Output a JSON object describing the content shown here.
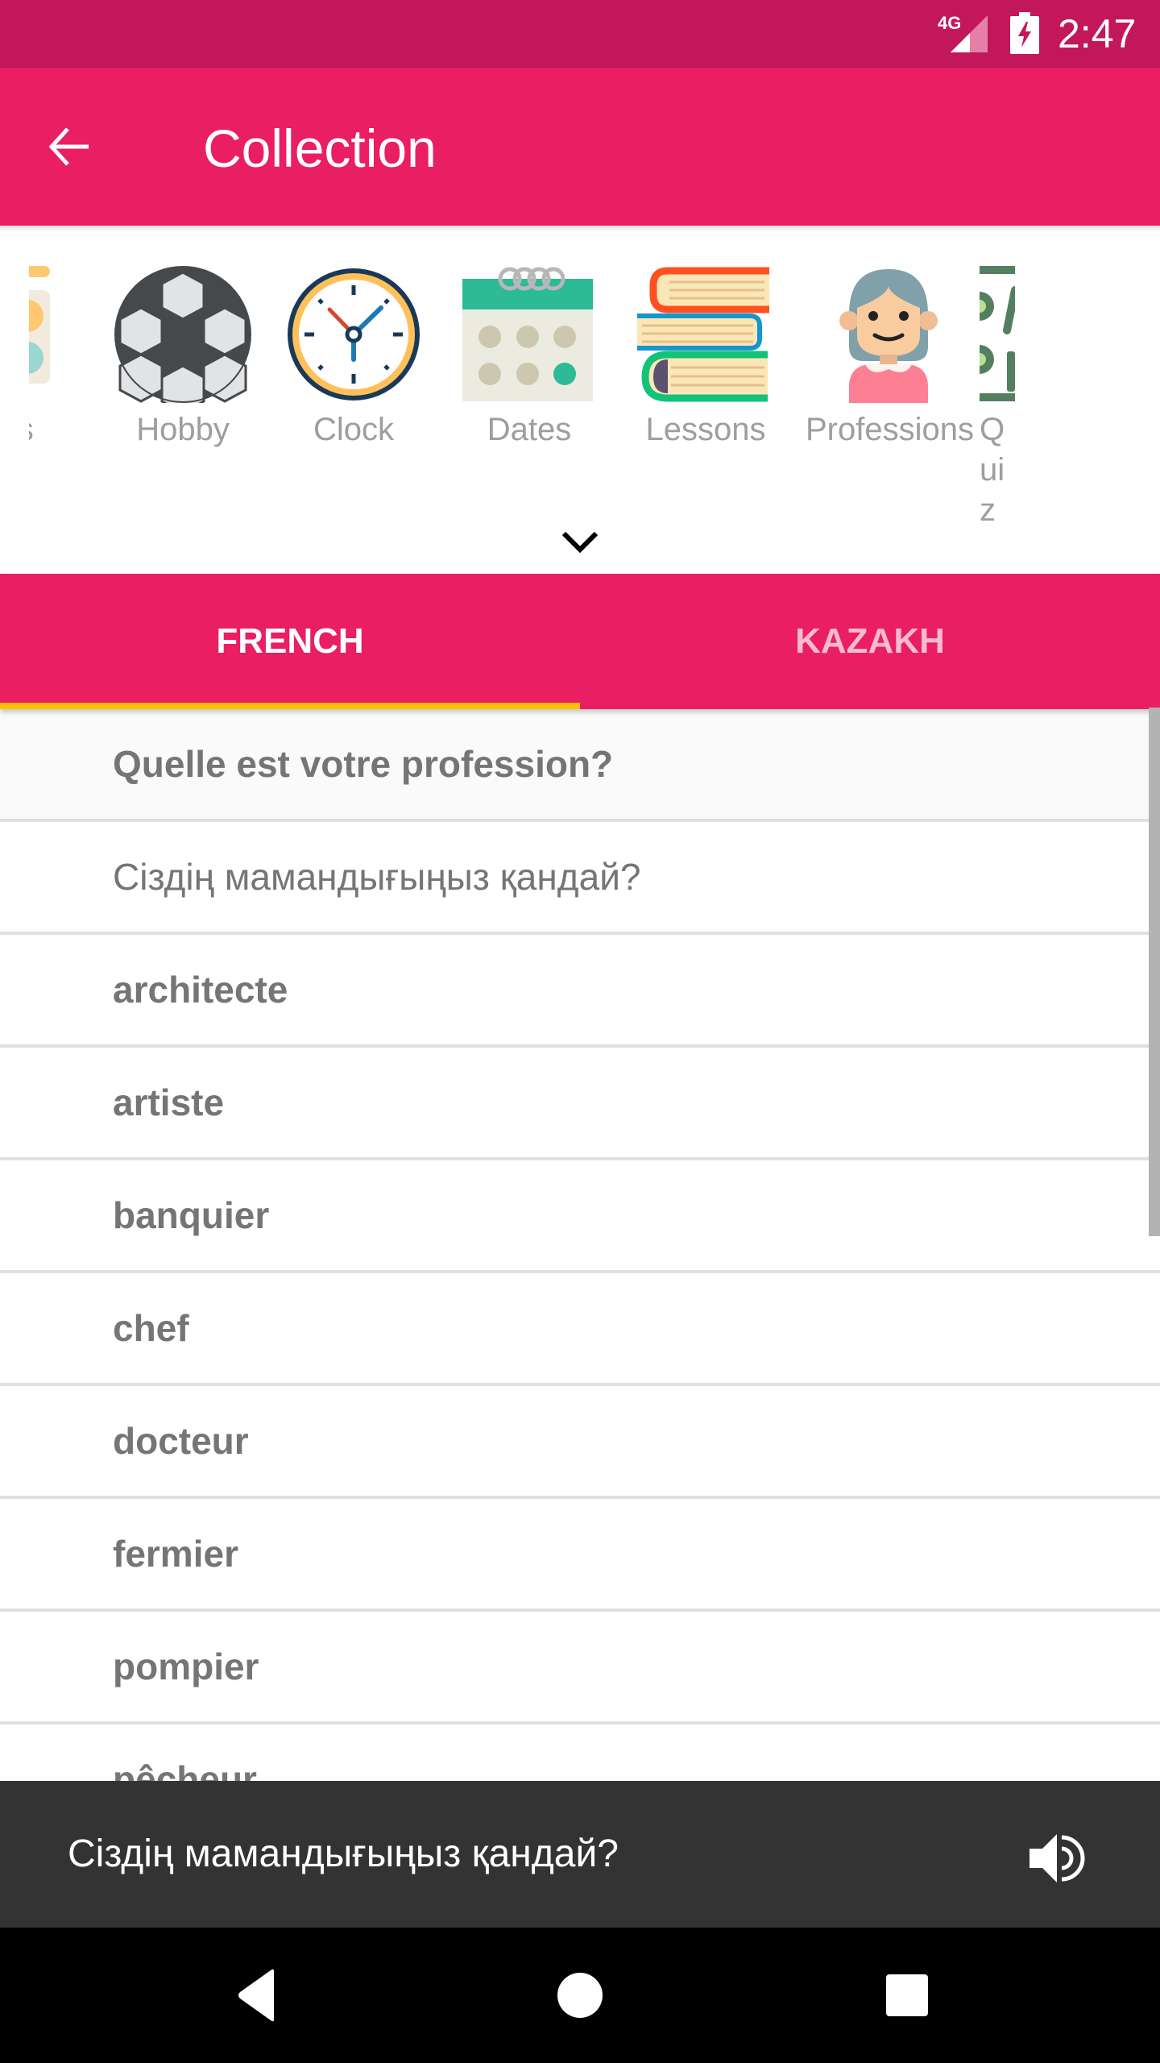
{
  "status_bar": {
    "network": "4G",
    "time": "2:47",
    "background_color": "#c2185b"
  },
  "app_bar": {
    "title": "Collection",
    "back_icon": "arrow-left-icon",
    "background_color": "#e91e63"
  },
  "categories": {
    "items": [
      {
        "label": "Colors",
        "visible_label": "ors",
        "icon": "palette-icon"
      },
      {
        "label": "Hobby",
        "visible_label": "Hobby",
        "icon": "soccer-ball-icon"
      },
      {
        "label": "Clock",
        "visible_label": "Clock",
        "icon": "clock-icon"
      },
      {
        "label": "Dates",
        "visible_label": "Dates",
        "icon": "calendar-icon"
      },
      {
        "label": "Lessons",
        "visible_label": "Lessons",
        "icon": "books-icon"
      },
      {
        "label": "Professions",
        "visible_label": "Professions",
        "icon": "person-icon"
      },
      {
        "label": "Quiz",
        "visible_label": "Quiz",
        "icon": "quiz-icon"
      }
    ],
    "expand_icon": "chevron-down-icon"
  },
  "tabs": [
    {
      "label": "FRENCH",
      "active": true
    },
    {
      "label": "KAZAKH",
      "active": false
    }
  ],
  "tab_indicator_color": "#ffc107",
  "list": {
    "header": {
      "french": "Quelle est votre profession?",
      "kazakh": "Сіздің мамандығыңыз қандай?"
    },
    "items": [
      "architecte",
      "artiste",
      "banquier",
      "chef",
      "docteur",
      "fermier",
      "pompier",
      "pêcheur"
    ]
  },
  "player": {
    "phrase": "Сіздің мамандығыңыз қандай?",
    "speaker_icon": "volume-icon"
  },
  "nav_bar": {
    "buttons": [
      "back",
      "home",
      "recents"
    ]
  }
}
